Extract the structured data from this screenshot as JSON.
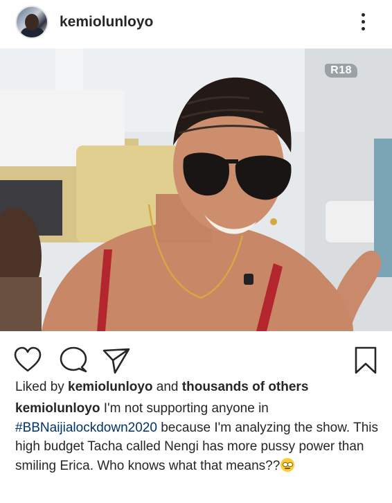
{
  "post": {
    "username": "kemiolunloyo",
    "more_label": "More options",
    "badge": "R18"
  },
  "likes": {
    "prefix": "Liked by ",
    "user": "kemiolunloyo",
    "mid": " and ",
    "others": "thousands of others"
  },
  "caption": {
    "user": "kemiolunloyo",
    "text1": " I'm not supporting anyone in ",
    "hashtag": "#BBNaijialockdown2020",
    "text2": " because I'm analyzing the show. This high budget Tacha called Nengi has more pussy power than smiling Erica. Who knows what that means??"
  },
  "icons": [
    "heart-icon",
    "comment-icon",
    "share-icon",
    "bookmark-icon",
    "more-icon",
    "face-with-rolling-eyes-emoji"
  ],
  "colors": {
    "text": "#262626",
    "hashtag": "#003569"
  }
}
